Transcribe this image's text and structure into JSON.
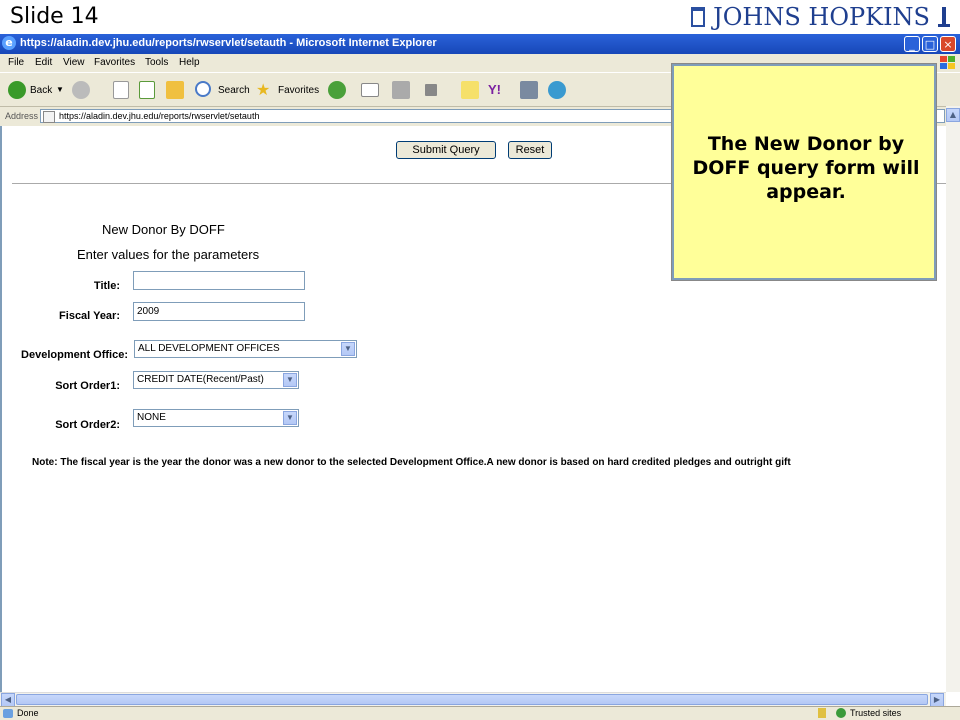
{
  "slide": {
    "title": "Slide 14",
    "logo_text": "JOHNS HOPKINS"
  },
  "window": {
    "title": "https://aladin.dev.jhu.edu/reports/rwservlet/setauth - Microsoft Internet Explorer",
    "minimize": "_",
    "maximize": "□",
    "close": "×"
  },
  "menu": {
    "file": "File",
    "edit": "Edit",
    "view": "View",
    "favorites": "Favorites",
    "tools": "Tools",
    "help": "Help"
  },
  "toolbar": {
    "back": "Back",
    "search": "Search",
    "favorites": "Favorites"
  },
  "address": {
    "label": "Address",
    "url": "https://aladin.dev.jhu.edu/reports/rwservlet/setauth"
  },
  "form": {
    "submit_label": "Submit Query",
    "reset_label": "Reset",
    "report_title": "New Donor By DOFF",
    "instructions": "Enter values for the parameters",
    "title_label": "Title:",
    "title_value": "",
    "fiscal_year_label": "Fiscal Year:",
    "fiscal_year_value": "2009",
    "dev_office_label": "Development Office:",
    "dev_office_value": "ALL DEVELOPMENT OFFICES",
    "sort1_label": "Sort Order1:",
    "sort1_value": "CREDIT DATE(Recent/Past)",
    "sort2_label": "Sort Order2:",
    "sort2_value": "NONE",
    "note": "Note: The fiscal year is the year the donor was a new donor to the selected Development Office.A new donor is based on hard credited pledges and outright gift"
  },
  "status": {
    "left": "Done",
    "right": "Trusted sites"
  },
  "callout": {
    "text": "The New Donor by DOFF query form will appear."
  },
  "colors": {
    "callout_bg": "#ffff99",
    "titlebar": "#1f54c8",
    "chrome": "#ece9d8"
  }
}
